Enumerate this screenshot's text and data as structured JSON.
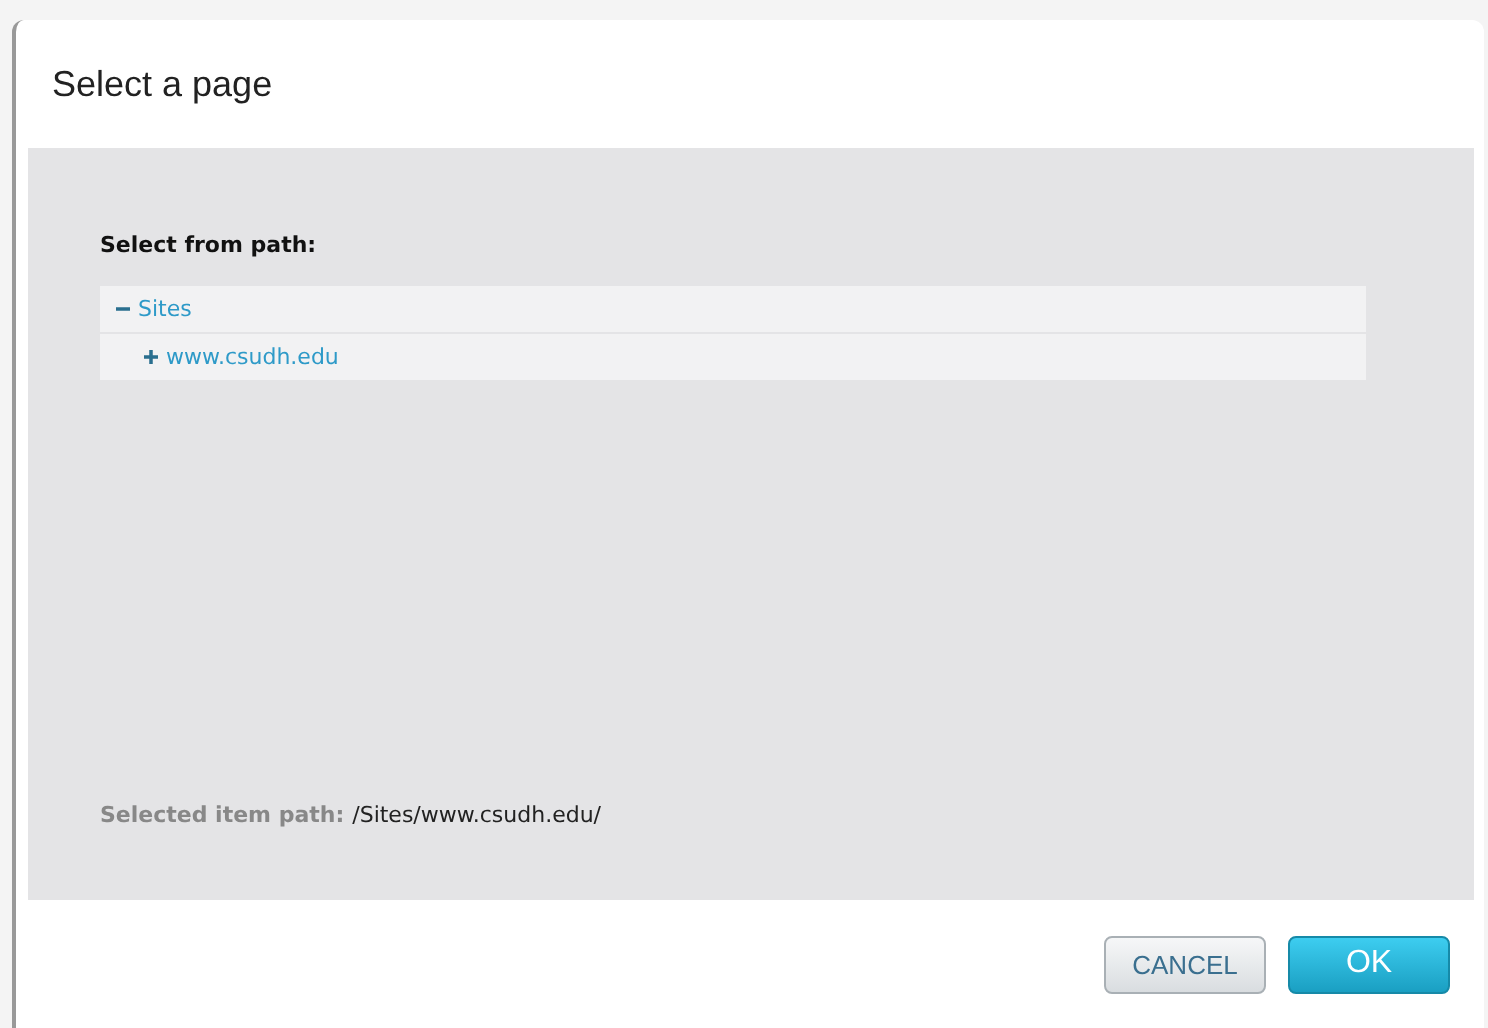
{
  "dialog": {
    "title": "Select a page"
  },
  "tree": {
    "heading": "Select from path:",
    "items": [
      {
        "label": "Sites",
        "expanded": true,
        "children": [
          {
            "label": "www.csudh.edu",
            "expanded": false
          }
        ]
      }
    ]
  },
  "selected_path": {
    "label": "Selected item path:",
    "value": "/Sites/www.csudh.edu/"
  },
  "buttons": [
    {
      "label": "CANCEL",
      "kind": "secondary"
    },
    {
      "label": "OK",
      "kind": "primary"
    }
  ]
}
